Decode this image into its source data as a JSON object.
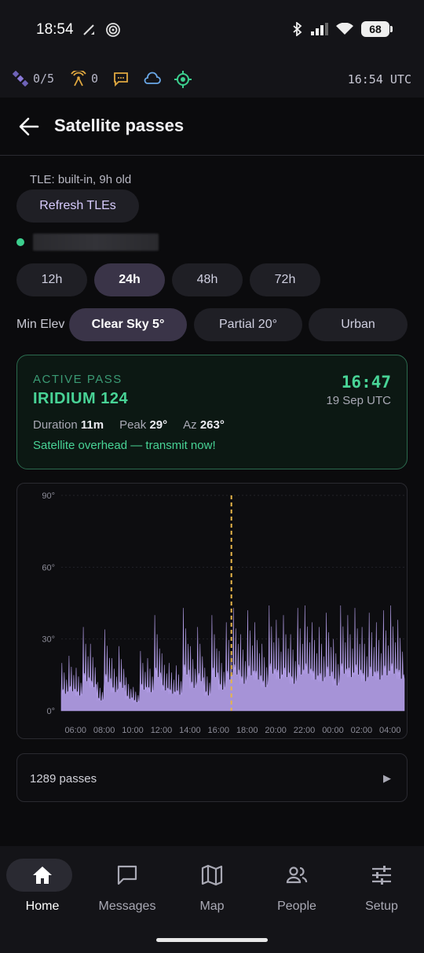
{
  "status_bar": {
    "time": "18:54",
    "battery": "68"
  },
  "app_status": {
    "satellites": "0/5",
    "antenna": "0",
    "utc_time": "16:54 UTC"
  },
  "header": {
    "title": "Satellite passes"
  },
  "tle": {
    "status": "TLE: built-in, 9h old",
    "refresh_label": "Refresh TLEs"
  },
  "window_options": [
    {
      "label": "12h",
      "selected": false
    },
    {
      "label": "24h",
      "selected": true
    },
    {
      "label": "48h",
      "selected": false
    },
    {
      "label": "72h",
      "selected": false
    }
  ],
  "min_elev": {
    "label": "Min Elev",
    "options": [
      {
        "label": "Clear Sky 5°",
        "selected": true
      },
      {
        "label": "Partial 20°",
        "selected": false
      },
      {
        "label": "Urban",
        "selected": false
      }
    ]
  },
  "active_pass": {
    "label": "ACTIVE PASS",
    "satellite": "IRIDIUM 124",
    "time": "16:47",
    "date": "19 Sep UTC",
    "duration_label": "Duration",
    "duration": "11m",
    "peak_label": "Peak",
    "peak": "29°",
    "az_label": "Az",
    "az": "263°",
    "message": "Satellite overhead — transmit now!"
  },
  "chart_data": {
    "type": "area",
    "y_ticks": [
      "90°",
      "60°",
      "30°",
      "0°"
    ],
    "ylim": [
      0,
      90
    ],
    "x_ticks": [
      "06:00",
      "08:00",
      "10:00",
      "12:00",
      "14:00",
      "16:00",
      "18:00",
      "20:00",
      "22:00",
      "00:00",
      "02:00",
      "04:00"
    ],
    "x_hours": [
      5.0,
      5.5,
      6.0,
      6.5,
      7.0,
      7.5,
      8.0,
      8.5,
      9.0,
      9.5,
      10.0,
      10.5,
      11.0,
      11.5,
      12.0,
      12.5,
      13.0,
      13.5,
      14.0,
      14.5,
      15.0,
      15.5,
      16.0,
      16.5,
      17.0,
      17.5,
      18.0,
      18.5,
      19.0,
      19.5,
      20.0,
      20.5,
      21.0,
      21.5,
      22.0,
      22.5,
      23.0,
      23.5,
      24.0,
      24.5,
      25.0,
      25.5,
      26.0,
      26.5,
      27.0,
      27.5,
      28.0,
      28.5
    ],
    "peak_elevation": [
      20,
      23,
      18,
      35,
      28,
      12,
      34,
      22,
      27,
      14,
      10,
      25,
      22,
      40,
      24,
      20,
      19,
      43,
      27,
      35,
      18,
      40,
      25,
      37,
      43,
      32,
      42,
      37,
      28,
      44,
      38,
      40,
      32,
      43,
      44,
      37,
      35,
      41,
      30,
      44,
      40,
      43,
      35,
      41,
      37,
      42,
      44,
      38
    ],
    "current_time_hour": 16.9,
    "color": "#b39ee8",
    "marker_color": "#e8b64a"
  },
  "passes_summary": {
    "label": "1289 passes",
    "arrow": "▶"
  },
  "bottom_nav": [
    {
      "label": "Home",
      "icon": "home-icon",
      "active": true
    },
    {
      "label": "Messages",
      "icon": "messages-icon",
      "active": false
    },
    {
      "label": "Map",
      "icon": "map-icon",
      "active": false
    },
    {
      "label": "People",
      "icon": "people-icon",
      "active": false
    },
    {
      "label": "Setup",
      "icon": "setup-icon",
      "active": false
    }
  ]
}
